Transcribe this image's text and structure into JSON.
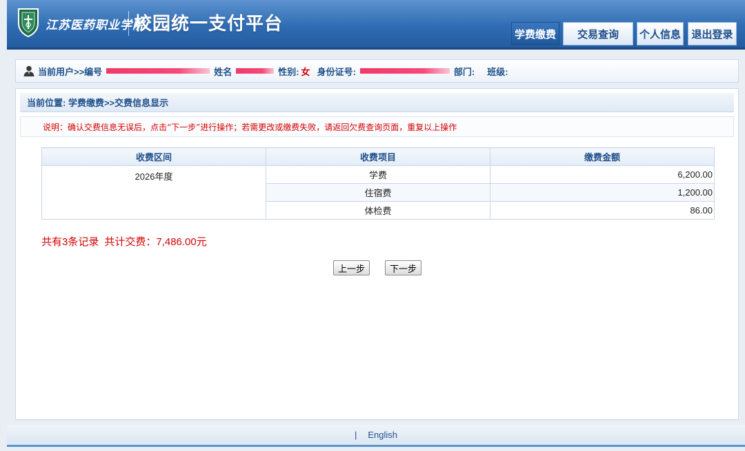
{
  "header": {
    "school_name": "江苏医药职业学院",
    "platform_title": "校园统一支付平台",
    "tabs": [
      {
        "label": "学费缴费",
        "active": true
      },
      {
        "label": "交易查询",
        "active": false
      },
      {
        "label": "个人信息",
        "active": false
      },
      {
        "label": "退出登录",
        "active": false
      }
    ]
  },
  "userbar": {
    "current_user_label": "当前用户>>编号",
    "name_label": "姓名",
    "gender_label": "性别:",
    "gender_value": "女",
    "id_label": "身份证号:",
    "dept_label": "部门:",
    "class_label": "班级:"
  },
  "location": {
    "text": "当前位置: 学费缴费>>交费信息显示"
  },
  "notice": {
    "text": "说明：确认交费信息无误后，点击“下一步”进行操作；若需更改或缴费失败，请返回欠费查询页面，重复以上操作"
  },
  "table": {
    "headers": [
      "收费区间",
      "收费项目",
      "缴费金额"
    ],
    "period": "2026年度",
    "rows": [
      {
        "item": "学费",
        "amount": "6,200.00"
      },
      {
        "item": "住宿费",
        "amount": "1,200.00"
      },
      {
        "item": "体检费",
        "amount": "86.00"
      }
    ]
  },
  "summary": {
    "records": "共有3条记录",
    "total": "共计交费：7,486.00元"
  },
  "buttons": {
    "prev": "上一步",
    "next": "下一步"
  },
  "footer": {
    "separator": "|",
    "language_link": "English"
  },
  "colors": {
    "header_blue": "#2f6cb3",
    "accent_text": "#1f4f8a",
    "alert_red": "#d40000"
  }
}
